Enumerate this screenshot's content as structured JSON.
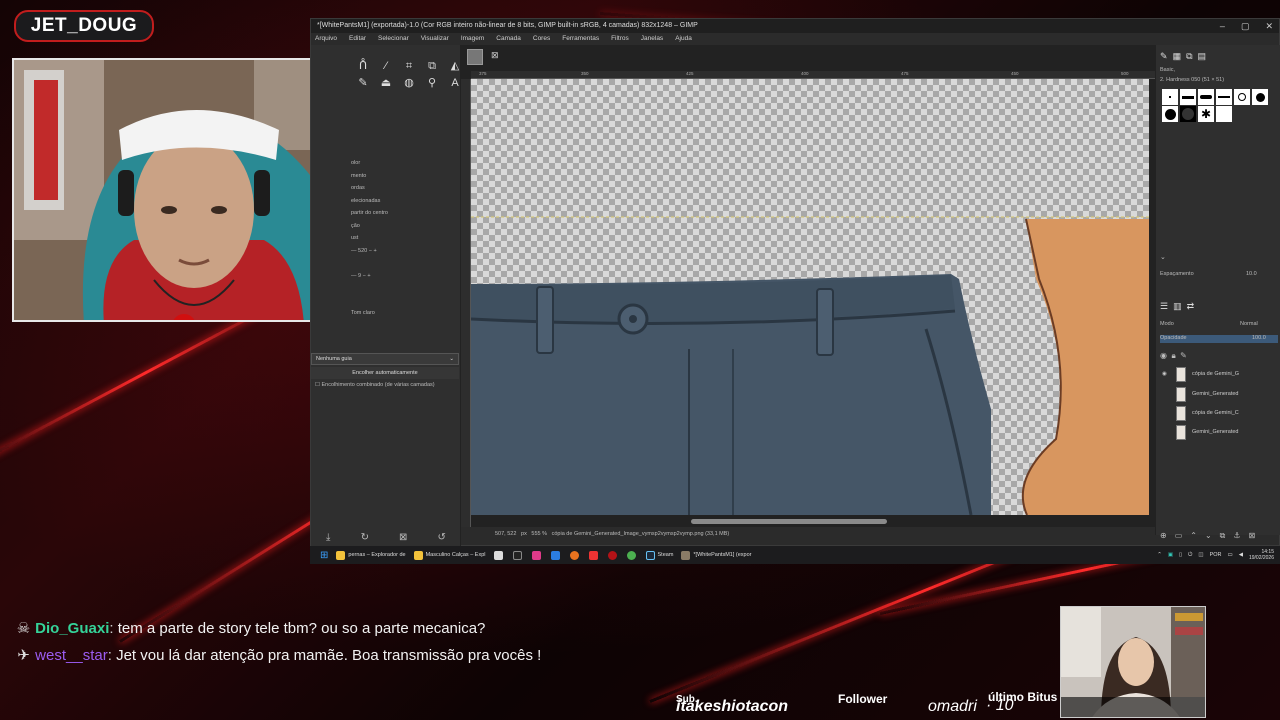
{
  "overlay": {
    "streamer_name": "JET_DOUG",
    "colors": {
      "accent": "#c21d1d",
      "chat_user1": "#35d399",
      "chat_user2": "#9b5cf0"
    }
  },
  "gimp": {
    "title": "*[WhitePantsM1] (exportada)-1.0 (Cor RGB inteiro não-linear de 8 bits, GIMP built-in sRGB, 4 camadas) 832x1248 – GIMP",
    "menus": [
      "Arquivo",
      "Editar",
      "Selecionar",
      "Visualizar",
      "Imagem",
      "Camada",
      "Cores",
      "Ferramentas",
      "Filtros",
      "Janelas",
      "Ajuda"
    ],
    "tool_options": {
      "rows": [
        "olor",
        "mento",
        "ordas",
        "elecionadas",
        "partir do centro",
        "ção",
        "ust",
        "",
        "",
        "",
        "",
        "",
        "Tom claro"
      ],
      "size_a": "520",
      "size_b": "9",
      "guides_select": "Nenhuma guia",
      "auto_button": "Encolher automaticamente",
      "combined": "Encolhimento combinado (de várias camadas)"
    },
    "ruler_ticks": [
      "375",
      "350",
      "425",
      "400",
      "475",
      "450",
      "500"
    ],
    "status": {
      "coords": "507, 522",
      "unit": "px",
      "zoom": "555 %",
      "file": "cópia de Gemini_Generated_Image_vymsp2vymsp2vymp.png (33,1 MB)"
    },
    "dock": {
      "brush_set": "Basic,",
      "brush_name": "2. Hardness 050 (51 × 51)",
      "spacing_label": "Espaçamento",
      "spacing_value": "10.0",
      "mode_label": "Modo",
      "mode_value": "Normal",
      "opacity_label": "Opacidade",
      "opacity_value": "100.0",
      "layers": [
        "cópia de Gemini_G",
        "Gemini_Generated",
        "cópia de Gemini_C",
        "Gemini_Generated"
      ]
    }
  },
  "taskbar": {
    "items": [
      "pernas – Explorador de",
      "Masculino Calças – Expl",
      "Steam",
      "*[WhitePantsM1] (expor"
    ],
    "lang": "POR",
    "time": "14:15",
    "date": "19/02/2026"
  },
  "chat": [
    {
      "user": "Dio_Guaxi",
      "text": "tem a parte de story tele tbm? ou so a parte mecanica?"
    },
    {
      "user": "west__star",
      "text": "Jet vou lá dar atenção pra mamãe. Boa transmissão pra vocês !"
    }
  ],
  "alerts": {
    "sub_label": "Sub.",
    "sub_name": "itakeshiotacon",
    "follower_label": "Follower",
    "follower_name": "omadri",
    "bits_label": "último Bitus",
    "bits_value": "· 10"
  }
}
